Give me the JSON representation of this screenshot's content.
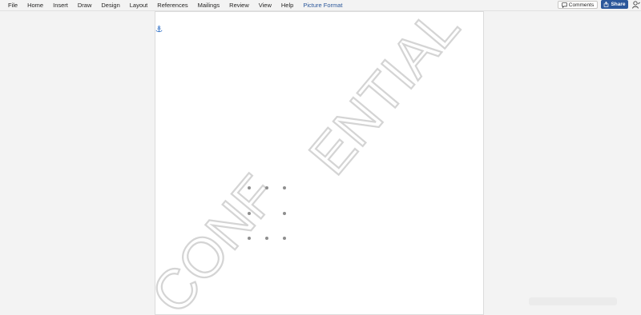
{
  "ribbon": {
    "tabs": [
      "File",
      "Home",
      "Insert",
      "Draw",
      "Design",
      "Layout",
      "References",
      "Mailings",
      "Review",
      "View",
      "Help",
      "Picture Format"
    ],
    "active_tab": "Picture Format",
    "comments_label": "Comments",
    "share_label": "Share",
    "accent_color": "#2b579a"
  },
  "document": {
    "watermark_part1": "CONF",
    "watermark_part2": "ENTIAL",
    "watermark_color": "#d9d9d9",
    "anchor_icon": "anchor-icon"
  }
}
